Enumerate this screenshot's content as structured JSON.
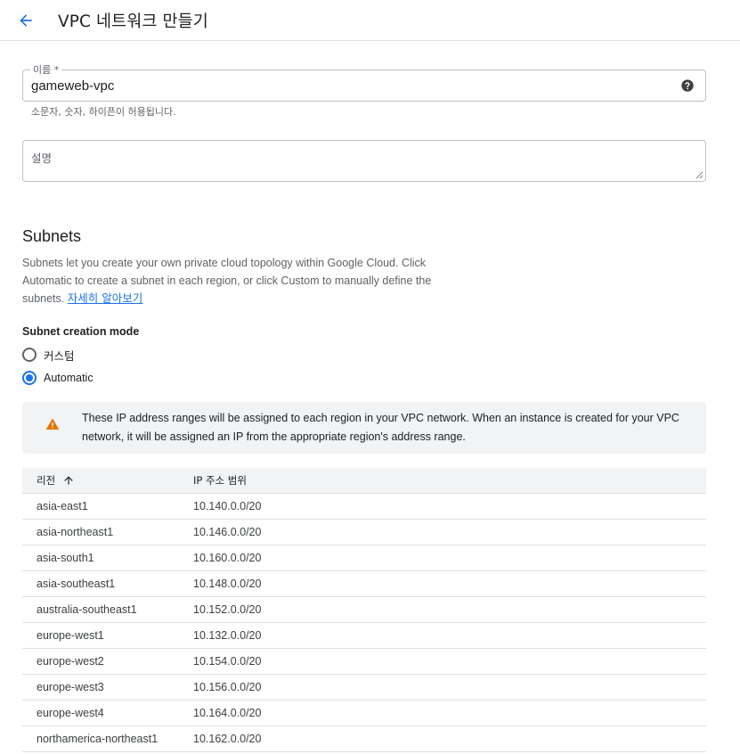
{
  "header": {
    "title": "VPC 네트워크 만들기"
  },
  "name_field": {
    "label": "이름 *",
    "value": "gameweb-vpc",
    "hint": "소문자, 숫자, 하이픈이 허용됩니다."
  },
  "description_field": {
    "placeholder": "설명"
  },
  "subnets": {
    "title": "Subnets",
    "description": "Subnets let you create your own private cloud topology within Google Cloud. Click Automatic to create a subnet in each region, or click Custom to manually define the subnets.",
    "learn_more": "자세히 알아보기",
    "mode_label": "Subnet creation mode",
    "modes": [
      {
        "label": "커스텀",
        "selected": false
      },
      {
        "label": "Automatic",
        "selected": true
      }
    ],
    "warning": "These IP address ranges will be assigned to each region in your VPC network. When an instance is created for your VPC network, it will be assigned an IP from the appropriate region's address range."
  },
  "table": {
    "columns": [
      "리전",
      "IP 주소 범위"
    ],
    "rows": [
      {
        "region": "asia-east1",
        "ip": "10.140.0.0/20"
      },
      {
        "region": "asia-northeast1",
        "ip": "10.146.0.0/20"
      },
      {
        "region": "asia-south1",
        "ip": "10.160.0.0/20"
      },
      {
        "region": "asia-southeast1",
        "ip": "10.148.0.0/20"
      },
      {
        "region": "australia-southeast1",
        "ip": "10.152.0.0/20"
      },
      {
        "region": "europe-west1",
        "ip": "10.132.0.0/20"
      },
      {
        "region": "europe-west2",
        "ip": "10.154.0.0/20"
      },
      {
        "region": "europe-west3",
        "ip": "10.156.0.0/20"
      },
      {
        "region": "europe-west4",
        "ip": "10.164.0.0/20"
      },
      {
        "region": "northamerica-northeast1",
        "ip": "10.162.0.0/20"
      }
    ]
  },
  "icons": {
    "back": "arrow-left-icon",
    "help": "help-circle-icon",
    "warning": "warning-triangle-icon",
    "sort": "arrow-up-icon"
  },
  "colors": {
    "accent": "#1a73e8",
    "warning": "#e37400",
    "panel": "#f1f3f4"
  }
}
